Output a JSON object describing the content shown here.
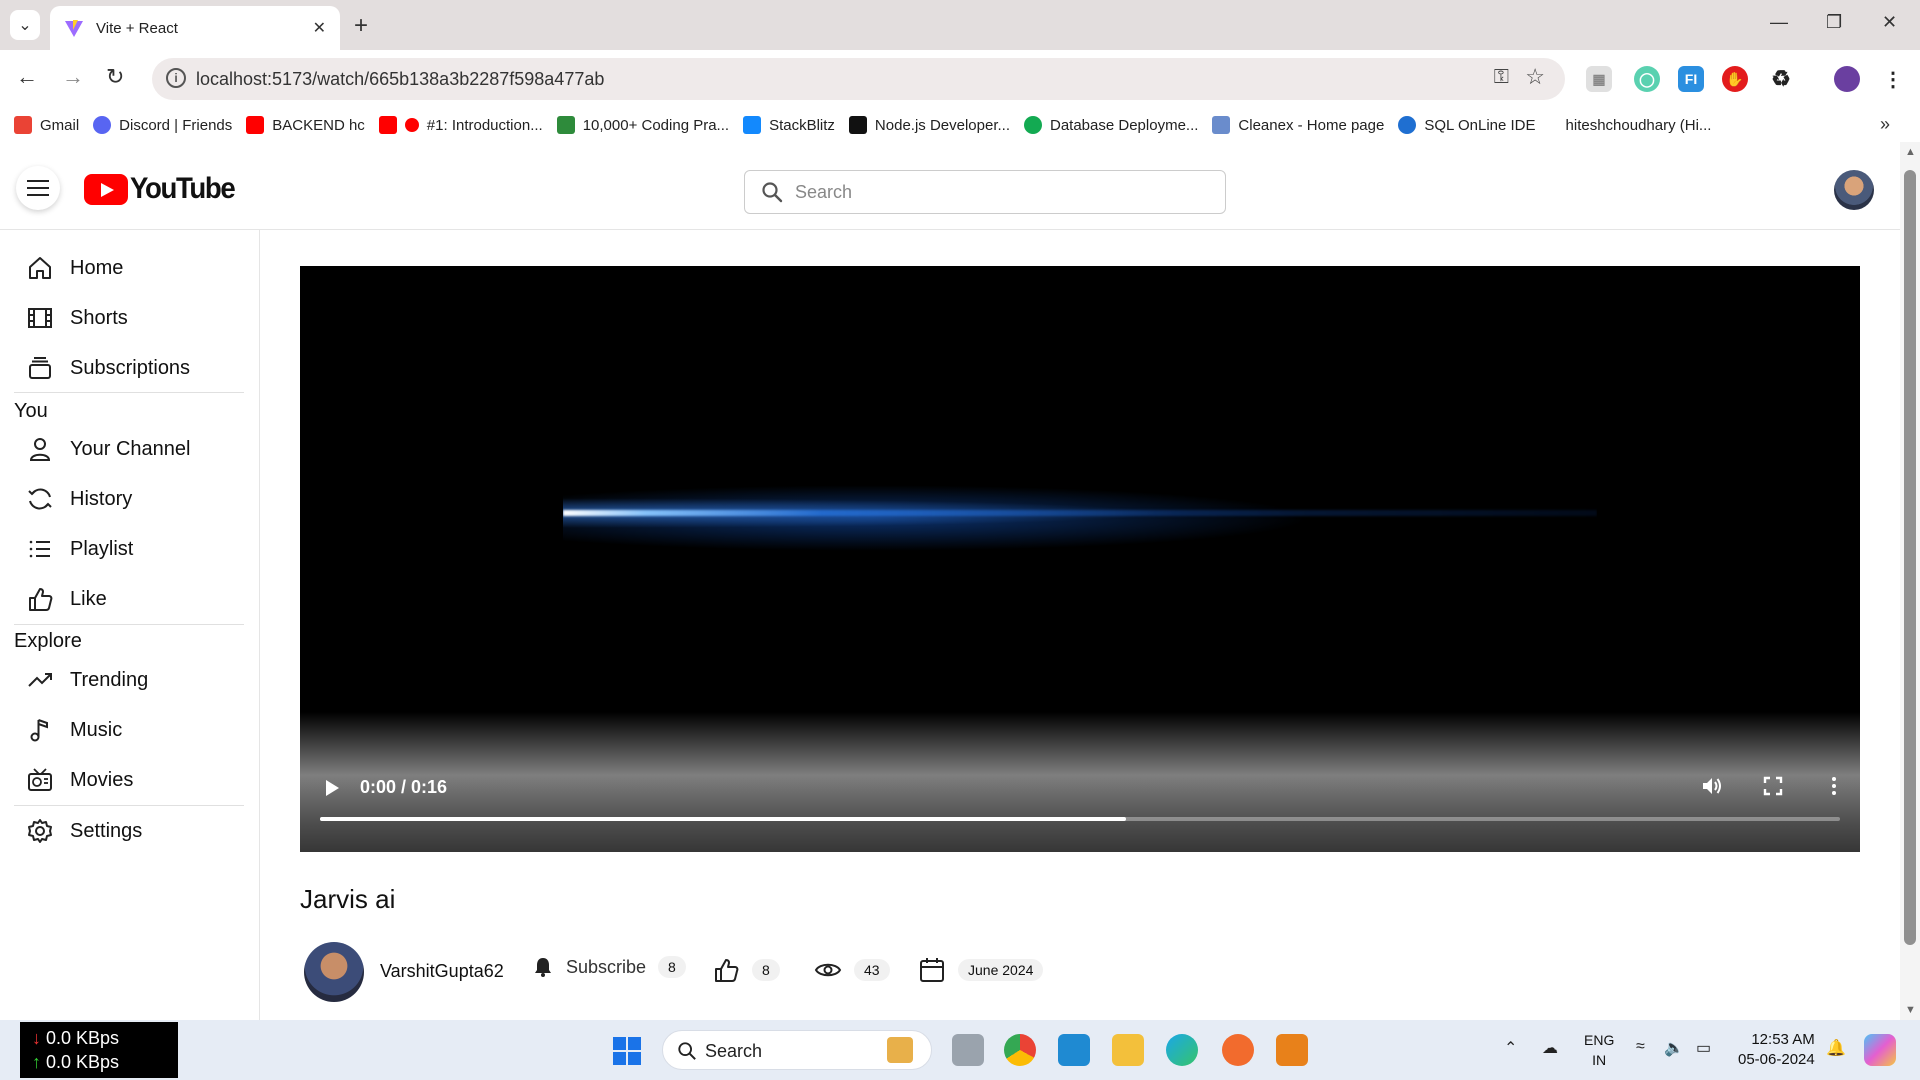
{
  "browser": {
    "tab_title": "Vite + React",
    "url": "localhost:5173/watch/665b138a3b2287f598a477ab",
    "bookmarks": [
      {
        "label": "Gmail",
        "color": "#ea4335"
      },
      {
        "label": "Discord | Friends",
        "color": "#5865f2"
      },
      {
        "label": "BACKEND hc",
        "color": "#ff0000"
      },
      {
        "label": "#1: Introduction...",
        "color": "#ff0000"
      },
      {
        "label": "10,000+ Coding Pra...",
        "color": "#2e8b3b"
      },
      {
        "label": "StackBlitz",
        "color": "#1389fd"
      },
      {
        "label": "Node.js Developer...",
        "color": "#111111"
      },
      {
        "label": "Database Deployme...",
        "color": "#13aa52"
      },
      {
        "label": "Cleanex - Home page",
        "color": "#6a8ccc"
      },
      {
        "label": "SQL OnLine IDE",
        "color": "#1f6fd1"
      },
      {
        "label": "hiteshchoudhary (Hi...",
        "color": "#ffffff"
      }
    ]
  },
  "header": {
    "logo_text": "YouTube",
    "search_placeholder": "Search"
  },
  "sidebar": {
    "items_top": [
      {
        "label": "Home",
        "icon": "home-icon"
      },
      {
        "label": "Shorts",
        "icon": "shorts-icon"
      },
      {
        "label": "Subscriptions",
        "icon": "subscriptions-icon"
      }
    ],
    "section_you": "You",
    "items_you": [
      {
        "label": "Your Channel",
        "icon": "user-icon"
      },
      {
        "label": "History",
        "icon": "history-icon"
      },
      {
        "label": "Playlist",
        "icon": "playlist-icon"
      },
      {
        "label": "Like",
        "icon": "like-icon"
      }
    ],
    "section_explore": "Explore",
    "items_explore": [
      {
        "label": "Trending",
        "icon": "trending-icon"
      },
      {
        "label": "Music",
        "icon": "music-icon"
      },
      {
        "label": "Movies",
        "icon": "movies-icon"
      }
    ],
    "settings": {
      "label": "Settings",
      "icon": "gear-icon"
    }
  },
  "player": {
    "time": "0:00 / 0:16",
    "buffered_fraction": 0.53
  },
  "video": {
    "title": "Jarvis ai",
    "channel": "VarshitGupta62",
    "subscribe_label": "Subscribe",
    "subscribers": "8",
    "likes": "8",
    "views": "43",
    "date": "June 2024"
  },
  "taskbar": {
    "net_down": "0.0 KBps",
    "net_up": "0.0 KBps",
    "search_label": "Search",
    "lang_line1": "ENG",
    "lang_line2": "IN",
    "time": "12:53 AM",
    "date": "05-06-2024"
  }
}
